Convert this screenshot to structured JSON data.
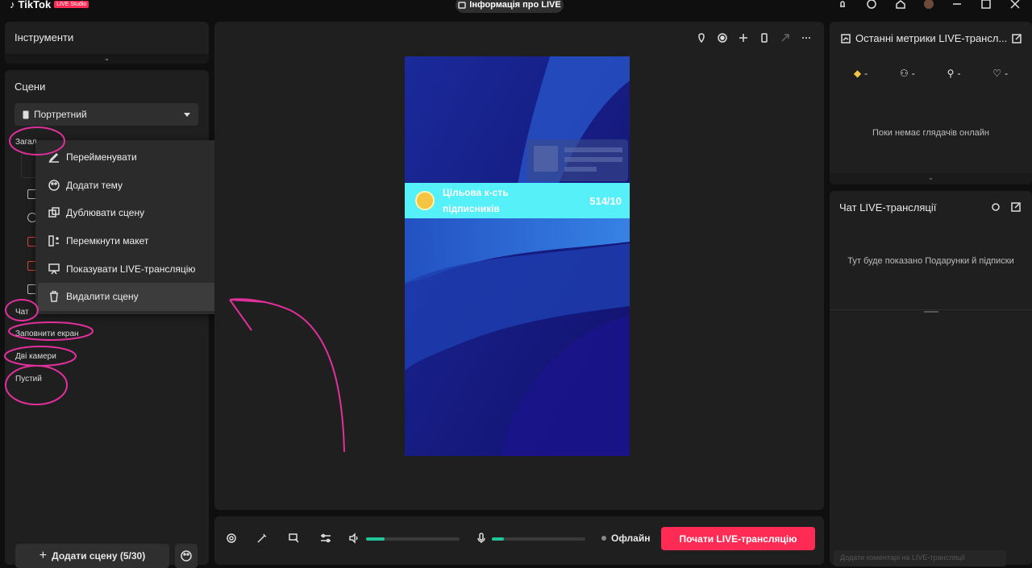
{
  "app": {
    "name": "TikTok",
    "badge": "LIVE Studio",
    "live_info": "Інформація про LIVE"
  },
  "tools": {
    "title": "Інструменти"
  },
  "scenes": {
    "title": "Сцени",
    "layout_selected": "Портретний",
    "items": [
      "Загал",
      "Чат",
      "Заповнити екран",
      "Дві камери",
      "Пустий"
    ],
    "add_button": "Додати сцену (5/30)"
  },
  "context_menu": {
    "items": [
      "Перейменувати",
      "Додати тему",
      "Дублювати сцену",
      "Перемкнути макет",
      "Показувати LIVE-трансляцію",
      "Видалити сцену"
    ],
    "highlighted": "Видалити сцену"
  },
  "preview": {
    "goal_label": "Цільова к-сть підписників",
    "goal_value": "514/10"
  },
  "bottom_bar": {
    "status": "Офлайн",
    "go_live": "Почати LIVE-трансляцію",
    "speaker_level": 0.2,
    "mic_level": 0.13
  },
  "metrics": {
    "title": "Останні метрики LIVE-трансл...",
    "values": [
      "-",
      "-",
      "-",
      "-"
    ],
    "empty": "Поки немає глядачів онлайн"
  },
  "chat": {
    "title": "Чат LIVE-трансляції",
    "placeholder": "Тут буде показано Подарунки й підписки",
    "input_placeholder": "Додати коментарі на LIVE-трансляції"
  },
  "colors": {
    "accent": "#fe2c55",
    "goal_bar": "#56f0f8",
    "meter": "#21c59b",
    "annotation": "#e0309b"
  }
}
